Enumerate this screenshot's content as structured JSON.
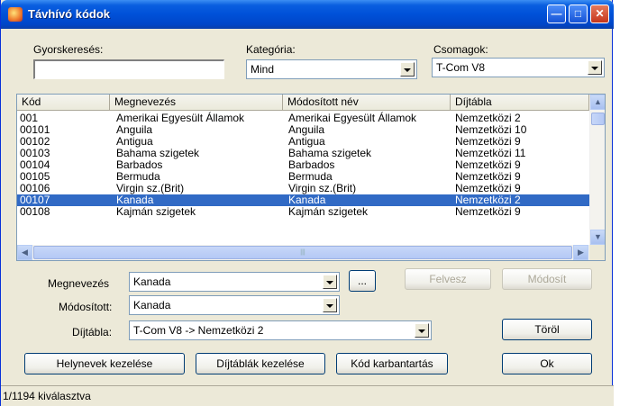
{
  "window": {
    "title": "Távhívó kódok"
  },
  "titlebar_buttons": [
    "minimize-icon",
    "maximize-icon",
    "close-icon"
  ],
  "search": {
    "label": "Gyorskeresés:",
    "value": ""
  },
  "category": {
    "label": "Kategória:",
    "value": "Mind"
  },
  "packages": {
    "label": "Csomagok:",
    "value": "T-Com V8"
  },
  "table": {
    "columns": [
      "Kód",
      "Megnevezés",
      "Módosított név",
      "Díjtábla"
    ],
    "rows": [
      {
        "code": "001",
        "name": "Amerikai Egyesült Államok",
        "modified": "Amerikai Egyesült Államok",
        "tariff": "Nemzetközi  2"
      },
      {
        "code": "00101",
        "name": "Anguila",
        "modified": "Anguila",
        "tariff": "Nemzetközi 10"
      },
      {
        "code": "00102",
        "name": "Antigua",
        "modified": "Antigua",
        "tariff": "Nemzetközi  9"
      },
      {
        "code": "00103",
        "name": "Bahama szigetek",
        "modified": "Bahama szigetek",
        "tariff": "Nemzetközi 11"
      },
      {
        "code": "00104",
        "name": "Barbados",
        "modified": "Barbados",
        "tariff": "Nemzetközi  9"
      },
      {
        "code": "00105",
        "name": "Bermuda",
        "modified": "Bermuda",
        "tariff": "Nemzetközi  9"
      },
      {
        "code": "00106",
        "name": "Virgin sz.(Brit)",
        "modified": "Virgin sz.(Brit)",
        "tariff": "Nemzetközi  9"
      },
      {
        "code": "00107",
        "name": "Kanada",
        "modified": "Kanada",
        "tariff": "Nemzetközi  2"
      },
      {
        "code": "00108",
        "name": "Kajmán szigetek",
        "modified": "Kajmán szigetek",
        "tariff": "Nemzetközi  9"
      }
    ],
    "selected_index": 7
  },
  "form": {
    "name_label": "Megnevezés",
    "name_value": "Kanada",
    "modified_label": "Módosított:",
    "modified_value": "Kanada",
    "tariff_label": "Díjtábla:",
    "tariff_value": "T-Com V8 -> Nemzetközi  2",
    "ellipsis_label": "..."
  },
  "buttons": {
    "add": "Felvesz",
    "modify": "Módosít",
    "delete": "Töröl",
    "places": "Helynevek kezelése",
    "tariffs": "Díjtáblák kezelése",
    "codes": "Kód karbantartás",
    "ok": "Ok"
  },
  "status": {
    "text": "1/1194 kiválasztva"
  },
  "colors": {
    "selection": "#316ac5",
    "titlebar": "#0050d8",
    "dialog_bg": "#ece9d8"
  }
}
